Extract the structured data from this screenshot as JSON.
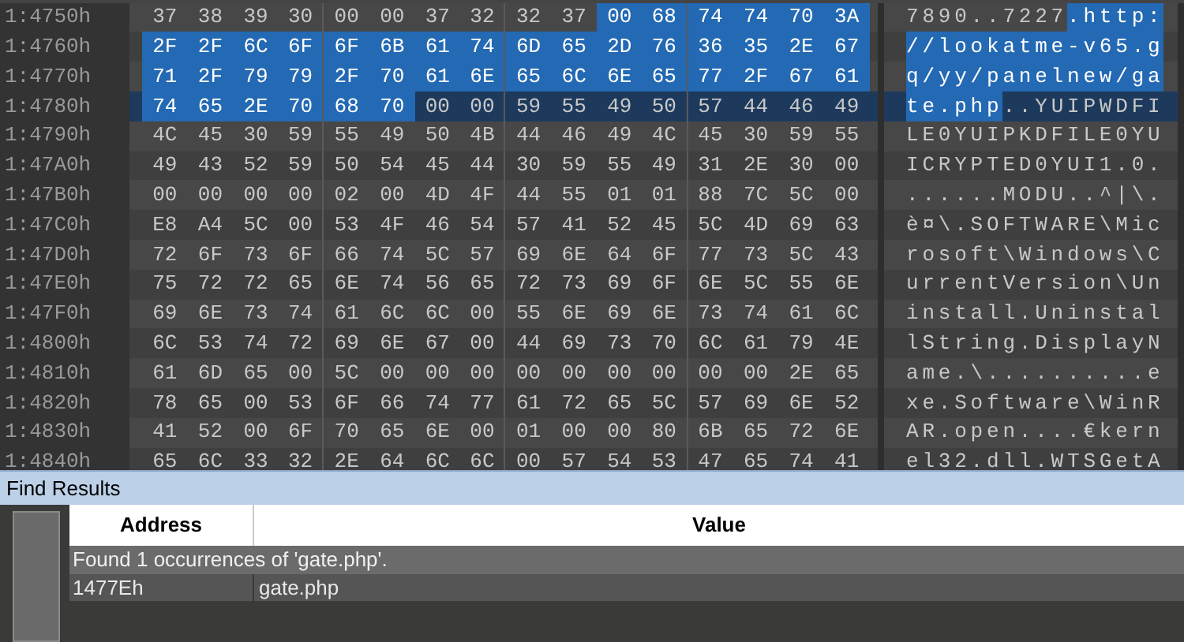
{
  "hex_view": {
    "rows": [
      {
        "address": "1:4750h",
        "current": false,
        "hex": [
          {
            "text": "37 38 39 30 00 00 37 32 32 37",
            "selected": false
          },
          {
            "text": "00 68 74 74 70 3A",
            "selected": true
          }
        ],
        "ascii": [
          {
            "text": "7890..7227",
            "selected": false
          },
          {
            "text": ".http:",
            "selected": true
          }
        ]
      },
      {
        "address": "1:4760h",
        "current": false,
        "hex": [
          {
            "text": "2F 2F 6C 6F 6F 6B 61 74 6D 65 2D 76 36 35 2E 67",
            "selected": true
          }
        ],
        "ascii": [
          {
            "text": "//lookatme-v65.g",
            "selected": true
          }
        ]
      },
      {
        "address": "1:4770h",
        "current": false,
        "hex": [
          {
            "text": "71 2F 79 79 2F 70 61 6E 65 6C 6E 65 77 2F 67 61",
            "selected": true
          }
        ],
        "ascii": [
          {
            "text": "q/yy/panelnew/ga",
            "selected": true
          }
        ]
      },
      {
        "address": "1:4780h",
        "current": true,
        "hex": [
          {
            "text": "74 65 2E 70 68 70",
            "selected": true
          },
          {
            "text": "00 00 59 55 49 50 57 44 46 49",
            "selected": false
          }
        ],
        "ascii": [
          {
            "text": "te.php",
            "selected": true
          },
          {
            "text": "..YUIPWDFI",
            "selected": false
          }
        ]
      },
      {
        "address": "1:4790h",
        "current": false,
        "hex": [
          {
            "text": "4C 45 30 59 55 49 50 4B 44 46 49 4C 45 30 59 55",
            "selected": false
          }
        ],
        "ascii": [
          {
            "text": "LE0YUIPKDFILE0YU",
            "selected": false
          }
        ]
      },
      {
        "address": "1:47A0h",
        "current": false,
        "hex": [
          {
            "text": "49 43 52 59 50 54 45 44 30 59 55 49 31 2E 30 00",
            "selected": false
          }
        ],
        "ascii": [
          {
            "text": "ICRYPTED0YUI1.0.",
            "selected": false
          }
        ]
      },
      {
        "address": "1:47B0h",
        "current": false,
        "hex": [
          {
            "text": "00 00 00 00 02 00 4D 4F 44 55 01 01 88 7C 5C 00",
            "selected": false
          }
        ],
        "ascii": [
          {
            "text": "......MODU..^|\\.",
            "selected": false
          }
        ]
      },
      {
        "address": "1:47C0h",
        "current": false,
        "hex": [
          {
            "text": "E8 A4 5C 00 53 4F 46 54 57 41 52 45 5C 4D 69 63",
            "selected": false
          }
        ],
        "ascii": [
          {
            "text": "è¤\\.SOFTWARE\\Mic",
            "selected": false
          }
        ]
      },
      {
        "address": "1:47D0h",
        "current": false,
        "hex": [
          {
            "text": "72 6F 73 6F 66 74 5C 57 69 6E 64 6F 77 73 5C 43",
            "selected": false
          }
        ],
        "ascii": [
          {
            "text": "rosoft\\Windows\\C",
            "selected": false
          }
        ]
      },
      {
        "address": "1:47E0h",
        "current": false,
        "hex": [
          {
            "text": "75 72 72 65 6E 74 56 65 72 73 69 6F 6E 5C 55 6E",
            "selected": false
          }
        ],
        "ascii": [
          {
            "text": "urrentVersion\\Un",
            "selected": false
          }
        ]
      },
      {
        "address": "1:47F0h",
        "current": false,
        "hex": [
          {
            "text": "69 6E 73 74 61 6C 6C 00 55 6E 69 6E 73 74 61 6C",
            "selected": false
          }
        ],
        "ascii": [
          {
            "text": "install.Uninstal",
            "selected": false
          }
        ]
      },
      {
        "address": "1:4800h",
        "current": false,
        "hex": [
          {
            "text": "6C 53 74 72 69 6E 67 00 44 69 73 70 6C 61 79 4E",
            "selected": false
          }
        ],
        "ascii": [
          {
            "text": "lString.DisplayN",
            "selected": false
          }
        ]
      },
      {
        "address": "1:4810h",
        "current": false,
        "hex": [
          {
            "text": "61 6D 65 00 5C 00 00 00 00 00 00 00 00 00 2E 65",
            "selected": false
          }
        ],
        "ascii": [
          {
            "text": "ame.\\..........e",
            "selected": false
          }
        ]
      },
      {
        "address": "1:4820h",
        "current": false,
        "hex": [
          {
            "text": "78 65 00 53 6F 66 74 77 61 72 65 5C 57 69 6E 52",
            "selected": false
          }
        ],
        "ascii": [
          {
            "text": "xe.Software\\WinR",
            "selected": false
          }
        ]
      },
      {
        "address": "1:4830h",
        "current": false,
        "hex": [
          {
            "text": "41 52 00 6F 70 65 6E 00 01 00 00 80 6B 65 72 6E",
            "selected": false
          }
        ],
        "ascii": [
          {
            "text": "AR.open....€kern",
            "selected": false
          }
        ]
      },
      {
        "address": "1:4840h",
        "current": false,
        "hex": [
          {
            "text": "65 6C 33 32 2E 64 6C 6C 00 57 54 53 47 65 74 41",
            "selected": false
          }
        ],
        "ascii": [
          {
            "text": "el32.dll.WTSGetA",
            "selected": false
          }
        ]
      }
    ]
  },
  "find_results": {
    "title": "Find Results",
    "columns": [
      "Address",
      "Value"
    ],
    "summary": "Found 1 occurrences of 'gate.php'.",
    "results": [
      {
        "address": "1477Eh",
        "value": "gate.php"
      }
    ]
  }
}
